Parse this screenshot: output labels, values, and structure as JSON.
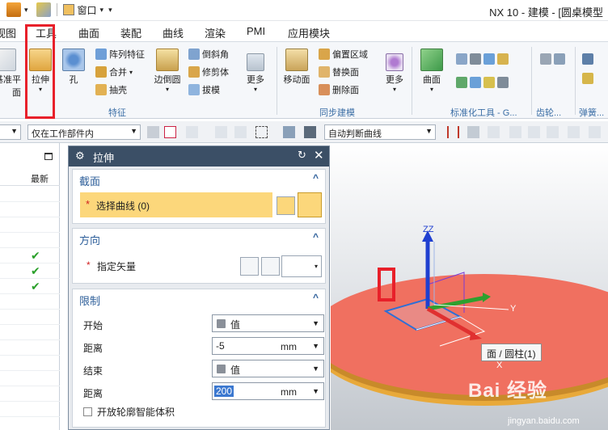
{
  "window": {
    "title": "NX 10 - 建模 - [圆桌模型"
  },
  "quick_access": {
    "window_menu": "窗口"
  },
  "menu": {
    "tabs": [
      "视图",
      "工具",
      "曲面",
      "装配",
      "曲线",
      "渲染",
      "PMI",
      "应用模块"
    ]
  },
  "ribbon": {
    "datum_plane": "基准平面",
    "extrude": "拉伸",
    "hole": "孔",
    "pattern_feature": "阵列特征",
    "unite": "合并",
    "shell": "抽壳",
    "edge_blend": "边倒圆",
    "chamfer": "倒斜角",
    "trim_body": "修剪体",
    "draft": "拔模",
    "more1": "更多",
    "move_face": "移动面",
    "offset_region": "偏置区域",
    "replace_face": "替换面",
    "delete_face": "删除面",
    "more2": "更多",
    "surface": "曲面",
    "group_feature": "特征",
    "group_sync": "同步建模",
    "group_standard": "标准化工具 - G...",
    "group_gear": "齿轮...",
    "group_spring": "弹簧..."
  },
  "toolbar": {
    "filter_label": "",
    "scope_value": "仅在工作部件内",
    "curve_rule": "自动判断曲线"
  },
  "navigator": {
    "col_latest": "最新",
    "checks": [
      "✔",
      "✔",
      "✔"
    ]
  },
  "dialog": {
    "title": "拉伸",
    "section": {
      "header": "截面",
      "select_curve": "选择曲线 (0)"
    },
    "direction": {
      "header": "方向",
      "specify_vector": "指定矢量"
    },
    "limits": {
      "header": "限制",
      "start_label": "开始",
      "start_value": "值",
      "start_distance_label": "距离",
      "start_distance": "-5",
      "start_unit": "mm",
      "end_label": "结束",
      "end_value": "值",
      "end_distance_label": "距离",
      "end_distance": "200",
      "end_unit": "mm",
      "open_profile": "开放轮廓智能体积"
    }
  },
  "viewport": {
    "tooltip": "面 / 圆柱(1)",
    "axis_z": "ZZ",
    "axis_y": "Y",
    "axis_x": "X",
    "watermark": "Bai 经验",
    "watermark_url": "jingyan.baidu.com"
  },
  "colors": {
    "table_top": "#f07060",
    "table_edge": "#e8a93a",
    "highlight_red": "#e8202a",
    "selection_yellow": "#fcd77b"
  }
}
